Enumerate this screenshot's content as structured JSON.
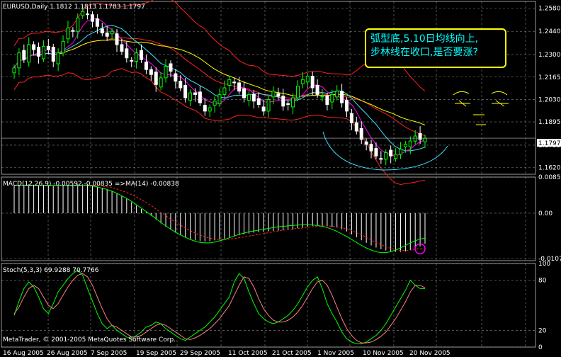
{
  "colors": {
    "background": "#000000",
    "grid": "#c0c0c0",
    "bull_candle": "#00ff00",
    "bear_candle": "#ffffff",
    "bollinger": "#ff2020",
    "ma_fast": "#ff00ff",
    "ma_slow": "#40e0ff",
    "ma_long": "#ffff00",
    "macd_signal": "#ff2020",
    "macd_line": "#00ff00",
    "stoch_main": "#00ff00",
    "stoch_signal": "#ff8080",
    "annotation_border": "#ffff00",
    "annotation_text": "#00ffff",
    "marker_circle": "#ff00ff",
    "curve_arc": "#40e0ff"
  },
  "price_panel": {
    "header": "EURUSD,Daily  1.1812 1.1813 1.1783 1.1797",
    "axis_labels": [
      "1.2580",
      "1.2440",
      "1.2300",
      "1.2165",
      "1.2030",
      "1.1895",
      "1.1755",
      "1.1620"
    ],
    "current_price": "1.1797",
    "annotation_line1": "弧型底,5.10日均线向上,",
    "annotation_line2": "步林线在收口,是否要涨?"
  },
  "macd_panel": {
    "header": "MACD(12,26,9) -0.00592 -0.00835 =>MA(14) -0.00838",
    "axis_labels": [
      "0.00852",
      "0.00",
      "-0.0107"
    ]
  },
  "stoch_panel": {
    "header": "Stoch(5,3,3) 69.9288 70.7766",
    "axis_labels": [
      "100",
      "80",
      "20",
      "0"
    ],
    "copyright": "MetaTrader, © 2001-2005 MetaQuotes Software Corp."
  },
  "date_axis": [
    "16 Aug 2005",
    "26 Aug 2005",
    "7 Sep 2005",
    "19 Sep 2005",
    "29 Sep 2005",
    "11 Oct 2005",
    "21 Oct 2005",
    "1 Nov 2005",
    "10 Nov 2005",
    "20 Nov 2005"
  ],
  "chart_data": [
    {
      "type": "candlestick",
      "title": "EURUSD,Daily",
      "ohlc_last": {
        "open": 1.1812,
        "high": 1.1813,
        "low": 1.1783,
        "close": 1.1797
      },
      "y_ticks": [
        1.258,
        1.244,
        1.23,
        1.2165,
        1.203,
        1.1895,
        1.1755,
        1.162
      ],
      "x_ticks": [
        "16 Aug 2005",
        "26 Aug 2005",
        "7 Sep 2005",
        "19 Sep 2005",
        "29 Sep 2005",
        "11 Oct 2005",
        "21 Oct 2005",
        "1 Nov 2005",
        "10 Nov 2005",
        "20 Nov 2005"
      ],
      "ylim": [
        1.158,
        1.262
      ],
      "closes": [
        1.222,
        1.231,
        1.227,
        1.236,
        1.233,
        1.229,
        1.235,
        1.233,
        1.226,
        1.231,
        1.238,
        1.246,
        1.244,
        1.252,
        1.256,
        1.254,
        1.25,
        1.247,
        1.243,
        1.241,
        1.244,
        1.236,
        1.232,
        1.228,
        1.226,
        1.231,
        1.227,
        1.221,
        1.218,
        1.212,
        1.216,
        1.223,
        1.22,
        1.214,
        1.21,
        1.204,
        1.207,
        1.206,
        1.201,
        1.196,
        1.198,
        1.202,
        1.206,
        1.21,
        1.215,
        1.213,
        1.208,
        1.204,
        1.206,
        1.202,
        1.2,
        1.196,
        1.203,
        1.208,
        1.205,
        1.199,
        1.2,
        1.204,
        1.211,
        1.215,
        1.217,
        1.21,
        1.206,
        1.205,
        1.2,
        1.206,
        1.208,
        1.201,
        1.196,
        1.189,
        1.184,
        1.179,
        1.176,
        1.172,
        1.169,
        1.167,
        1.171,
        1.169,
        1.17,
        1.173,
        1.176,
        1.178,
        1.181,
        1.179,
        1.1797
      ],
      "series": [
        {
          "name": "Bollinger Bands",
          "style": "upper/middle/lower"
        },
        {
          "name": "MA fast"
        },
        {
          "name": "MA slow"
        },
        {
          "name": "MA long"
        }
      ]
    },
    {
      "type": "bar",
      "title": "MACD(12,26,9)",
      "values_last": {
        "macd": -0.00592,
        "signal": -0.00835,
        "ma14": -0.00838
      },
      "ylim": [
        -0.0112,
        0.00852
      ],
      "y_ticks": [
        0.00852,
        0.0,
        -0.0107
      ],
      "histogram": [
        0.0065,
        0.0066,
        0.0067,
        0.0068,
        0.0067,
        0.0066,
        0.0066,
        0.0065,
        0.0064,
        0.0064,
        0.0065,
        0.0066,
        0.0067,
        0.0068,
        0.0068,
        0.0068,
        0.0066,
        0.0063,
        0.006,
        0.0056,
        0.0052,
        0.0046,
        0.004,
        0.0034,
        0.0026,
        0.0018,
        0.001,
        0.0002,
        -0.0006,
        -0.0015,
        -0.0024,
        -0.0032,
        -0.0039,
        -0.0046,
        -0.0052,
        -0.0057,
        -0.0061,
        -0.0064,
        -0.0066,
        -0.0067,
        -0.0066,
        -0.0064,
        -0.0062,
        -0.006,
        -0.0057,
        -0.0054,
        -0.0052,
        -0.005,
        -0.0048,
        -0.0046,
        -0.0045,
        -0.0044,
        -0.0043,
        -0.0042,
        -0.0041,
        -0.004,
        -0.0039,
        -0.0038,
        -0.0036,
        -0.0034,
        -0.0032,
        -0.003,
        -0.0029,
        -0.0029,
        -0.003,
        -0.0032,
        -0.0034,
        -0.0038,
        -0.0043,
        -0.005,
        -0.0057,
        -0.0064,
        -0.007,
        -0.0076,
        -0.0081,
        -0.0085,
        -0.0088,
        -0.009,
        -0.0091,
        -0.0091,
        -0.009,
        -0.0087,
        -0.0083,
        -0.0078,
        -0.0072
      ],
      "signal": [
        0.0066,
        0.0066,
        0.0066,
        0.0066,
        0.0066,
        0.0066,
        0.0066,
        0.0066,
        0.0066,
        0.0066,
        0.0066,
        0.0066,
        0.0066,
        0.0066,
        0.0066,
        0.0066,
        0.0066,
        0.0065,
        0.0064,
        0.0062,
        0.006,
        0.0057,
        0.0053,
        0.0049,
        0.0044,
        0.0038,
        0.0032,
        0.0025,
        0.0018,
        0.001,
        0.0002,
        -0.0006,
        -0.0014,
        -0.0021,
        -0.0028,
        -0.0035,
        -0.0041,
        -0.0047,
        -0.0052,
        -0.0056,
        -0.0059,
        -0.0061,
        -0.0062,
        -0.0062,
        -0.0061,
        -0.006,
        -0.0058,
        -0.0056,
        -0.0054,
        -0.0052,
        -0.005,
        -0.0048,
        -0.0046,
        -0.0044,
        -0.0042,
        -0.004,
        -0.0039,
        -0.0037,
        -0.0036,
        -0.0035,
        -0.0033,
        -0.0032,
        -0.0031,
        -0.003,
        -0.003,
        -0.0031,
        -0.0032,
        -0.0034,
        -0.0037,
        -0.0041,
        -0.0046,
        -0.0051,
        -0.0057,
        -0.0063,
        -0.0069,
        -0.0074,
        -0.0079,
        -0.0083,
        -0.0086,
        -0.0088,
        -0.0088,
        -0.0087,
        -0.0085,
        -0.0084,
        -0.0084
      ],
      "macd_line": [
        0.0066,
        0.0066,
        0.0066,
        0.0066,
        0.0066,
        0.0066,
        0.0066,
        0.0066,
        0.0066,
        0.0066,
        0.0066,
        0.0066,
        0.0066,
        0.0066,
        0.0066,
        0.0066,
        0.0064,
        0.0062,
        0.0059,
        0.0056,
        0.0052,
        0.0047,
        0.0041,
        0.0035,
        0.0028,
        0.002,
        0.0012,
        0.0004,
        -0.0004,
        -0.0013,
        -0.0022,
        -0.003,
        -0.0038,
        -0.0045,
        -0.0051,
        -0.0057,
        -0.0062,
        -0.0066,
        -0.0069,
        -0.007,
        -0.007,
        -0.0068,
        -0.0065,
        -0.0062,
        -0.0058,
        -0.0054,
        -0.005,
        -0.0047,
        -0.0044,
        -0.0042,
        -0.004,
        -0.0038,
        -0.0036,
        -0.0034,
        -0.0032,
        -0.0031,
        -0.003,
        -0.0029,
        -0.0028,
        -0.0027,
        -0.0027,
        -0.0028,
        -0.0029,
        -0.0031,
        -0.0034,
        -0.0038,
        -0.0043,
        -0.0049,
        -0.0055,
        -0.0062,
        -0.0069,
        -0.0076,
        -0.0082,
        -0.0087,
        -0.0091,
        -0.0093,
        -0.0093,
        -0.0091,
        -0.0087,
        -0.0082,
        -0.0076,
        -0.007,
        -0.0065,
        -0.0061,
        -0.0059
      ]
    },
    {
      "type": "line",
      "title": "Stoch(5,3,3)",
      "values_last": {
        "main": 69.9288,
        "signal": 70.7766
      },
      "ylim": [
        0,
        100
      ],
      "y_ticks": [
        100,
        80,
        20,
        0
      ],
      "series": [
        {
          "name": "main",
          "values": [
            38,
            55,
            70,
            78,
            72,
            60,
            46,
            40,
            52,
            66,
            74,
            82,
            88,
            92,
            86,
            70,
            55,
            40,
            28,
            22,
            26,
            20,
            16,
            12,
            10,
            14,
            18,
            24,
            26,
            30,
            28,
            22,
            18,
            14,
            10,
            8,
            12,
            16,
            20,
            24,
            30,
            36,
            44,
            52,
            60,
            78,
            88,
            82,
            66,
            52,
            40,
            34,
            30,
            28,
            30,
            34,
            38,
            44,
            52,
            62,
            72,
            80,
            84,
            70,
            52,
            40,
            30,
            18,
            10,
            6,
            4,
            4,
            6,
            10,
            14,
            20,
            28,
            38,
            48,
            58,
            68,
            80,
            74,
            70,
            70
          ]
        },
        {
          "name": "signal",
          "values": [
            40,
            48,
            60,
            70,
            74,
            70,
            60,
            50,
            46,
            52,
            62,
            72,
            80,
            86,
            88,
            84,
            74,
            60,
            46,
            34,
            26,
            24,
            20,
            16,
            12,
            12,
            14,
            18,
            22,
            26,
            28,
            26,
            22,
            18,
            14,
            10,
            9,
            11,
            14,
            18,
            22,
            28,
            34,
            42,
            50,
            62,
            74,
            84,
            82,
            72,
            58,
            46,
            38,
            32,
            30,
            30,
            32,
            36,
            42,
            50,
            60,
            70,
            78,
            80,
            74,
            62,
            48,
            34,
            22,
            14,
            8,
            5,
            5,
            6,
            9,
            13,
            18,
            26,
            34,
            44,
            54,
            66,
            74,
            74,
            71
          ]
        }
      ]
    }
  ]
}
